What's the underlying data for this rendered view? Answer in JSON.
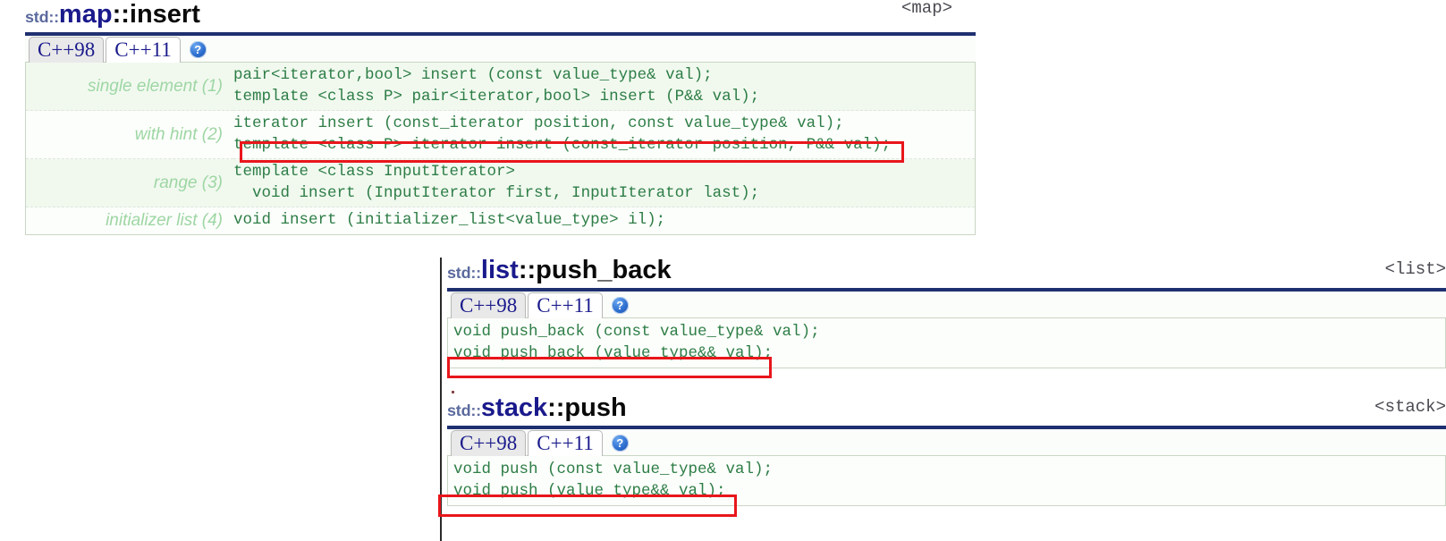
{
  "theme": {
    "rule_color": "#1f3070",
    "code_color": "#2d7d46",
    "label_color": "#9ed6a4",
    "tab_text_color": "#1a1a8c",
    "highlight_color": "#e8161b",
    "panel_bg": "#fcfefb",
    "row_tint_bg": "#f1f9ef"
  },
  "blocks": [
    {
      "id": "map-insert",
      "namespace": "std::",
      "class_name": "map",
      "separator": "::",
      "member": "insert",
      "header_include": "<map>",
      "tabs": [
        {
          "label": "C++98",
          "active": false
        },
        {
          "label": "C++11",
          "active": true
        }
      ],
      "help_icon_label": "?",
      "help_icon_name": "help-icon",
      "rows": [
        {
          "label": "single element (1)",
          "tint": true,
          "lines": [
            "pair<iterator,bool> insert (const value_type& val);",
            "template <class P> pair<iterator,bool> insert (P&& val);"
          ]
        },
        {
          "label": "with hint (2)",
          "tint": false,
          "lines": [
            "iterator insert (const_iterator position, const value_type& val);",
            "template <class P> iterator insert (const_iterator position, P&& val);"
          ]
        },
        {
          "label": "range (3)",
          "tint": true,
          "lines": [
            "template <class InputIterator>",
            "  void insert (InputIterator first, InputIterator last);"
          ]
        },
        {
          "label": "initializer list (4)",
          "tint": false,
          "lines": [
            "void insert (initializer_list<value_type> il);"
          ]
        }
      ]
    },
    {
      "id": "list-push-back",
      "namespace": "std::",
      "class_name": "list",
      "separator": "::",
      "member": "push_back",
      "header_include": "<list>",
      "tabs": [
        {
          "label": "C++98",
          "active": false
        },
        {
          "label": "C++11",
          "active": true
        }
      ],
      "help_icon_label": "?",
      "help_icon_name": "help-icon",
      "lines": [
        "void push_back (const value_type& val);",
        "void push_back (value_type&& val);"
      ]
    },
    {
      "id": "stack-push",
      "namespace": "std::",
      "class_name": "stack",
      "separator": "::",
      "member": "push",
      "header_include": "<stack>",
      "tabs": [
        {
          "label": "C++98",
          "active": false
        },
        {
          "label": "C++11",
          "active": true
        }
      ],
      "help_icon_label": "?",
      "help_icon_name": "help-icon",
      "lines": [
        "void push (const value_type& val);",
        "void push (value_type&& val);"
      ]
    }
  ],
  "annotations": [
    {
      "name": "highlight-map-move-insert",
      "target": "map template <class P> iterator insert (const_iterator position, P&& val);"
    },
    {
      "name": "highlight-list-move-push-back",
      "target": "void push_back (value_type&& val);"
    },
    {
      "name": "highlight-stack-move-push",
      "target": "void push (value_type&& val);"
    }
  ]
}
